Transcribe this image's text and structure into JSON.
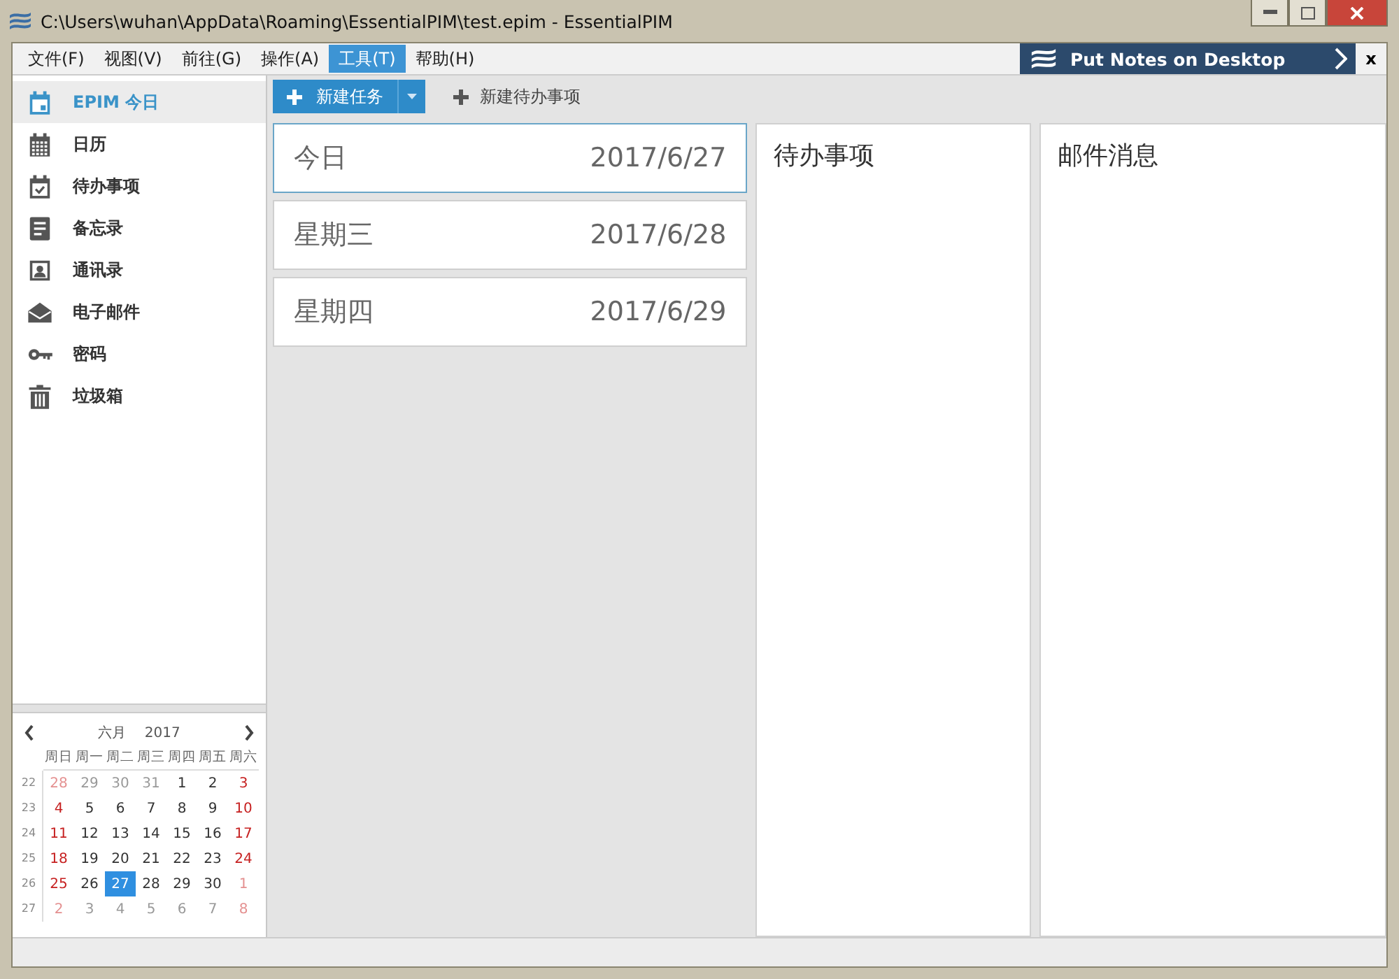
{
  "window": {
    "title": "C:\\Users\\wuhan\\AppData\\Roaming\\EssentialPIM\\test.epim - EssentialPIM"
  },
  "menu": [
    {
      "label": "文件(F)",
      "selected": false
    },
    {
      "label": "视图(V)",
      "selected": false
    },
    {
      "label": "前往(G)",
      "selected": false
    },
    {
      "label": "操作(A)",
      "selected": false
    },
    {
      "label": "工具(T)",
      "selected": true
    },
    {
      "label": "帮助(H)",
      "selected": false
    }
  ],
  "banner": {
    "text": "Put Notes on Desktop",
    "close": "x"
  },
  "sidebar": {
    "items": [
      {
        "label": "EPIM 今日",
        "kind": "today",
        "selected": true
      },
      {
        "label": "日历",
        "kind": "calendar",
        "selected": false
      },
      {
        "label": "待办事项",
        "kind": "todo",
        "selected": false
      },
      {
        "label": "备忘录",
        "kind": "note",
        "selected": false
      },
      {
        "label": "通讯录",
        "kind": "contact",
        "selected": false
      },
      {
        "label": "电子邮件",
        "kind": "mail",
        "selected": false
      },
      {
        "label": "密码",
        "kind": "key",
        "selected": false
      },
      {
        "label": "垃圾箱",
        "kind": "trash",
        "selected": false
      }
    ]
  },
  "mini_calendar": {
    "month": "六月",
    "year": "2017",
    "weekdays": [
      "周日",
      "周一",
      "周二",
      "周三",
      "周四",
      "周五",
      "周六"
    ],
    "weeks": [
      {
        "week": "22",
        "days": [
          {
            "d": "28",
            "other": true,
            "weekend": true,
            "selected": false
          },
          {
            "d": "29",
            "other": true,
            "weekend": false,
            "selected": false
          },
          {
            "d": "30",
            "other": true,
            "weekend": false,
            "selected": false
          },
          {
            "d": "31",
            "other": true,
            "weekend": false,
            "selected": false
          },
          {
            "d": "1",
            "other": false,
            "weekend": false,
            "selected": false
          },
          {
            "d": "2",
            "other": false,
            "weekend": false,
            "selected": false
          },
          {
            "d": "3",
            "other": false,
            "weekend": true,
            "selected": false
          }
        ]
      },
      {
        "week": "23",
        "days": [
          {
            "d": "4",
            "other": false,
            "weekend": true,
            "selected": false
          },
          {
            "d": "5",
            "other": false,
            "weekend": false,
            "selected": false
          },
          {
            "d": "6",
            "other": false,
            "weekend": false,
            "selected": false
          },
          {
            "d": "7",
            "other": false,
            "weekend": false,
            "selected": false
          },
          {
            "d": "8",
            "other": false,
            "weekend": false,
            "selected": false
          },
          {
            "d": "9",
            "other": false,
            "weekend": false,
            "selected": false
          },
          {
            "d": "10",
            "other": false,
            "weekend": true,
            "selected": false
          }
        ]
      },
      {
        "week": "24",
        "days": [
          {
            "d": "11",
            "other": false,
            "weekend": true,
            "selected": false
          },
          {
            "d": "12",
            "other": false,
            "weekend": false,
            "selected": false
          },
          {
            "d": "13",
            "other": false,
            "weekend": false,
            "selected": false
          },
          {
            "d": "14",
            "other": false,
            "weekend": false,
            "selected": false
          },
          {
            "d": "15",
            "other": false,
            "weekend": false,
            "selected": false
          },
          {
            "d": "16",
            "other": false,
            "weekend": false,
            "selected": false
          },
          {
            "d": "17",
            "other": false,
            "weekend": true,
            "selected": false
          }
        ]
      },
      {
        "week": "25",
        "days": [
          {
            "d": "18",
            "other": false,
            "weekend": true,
            "selected": false
          },
          {
            "d": "19",
            "other": false,
            "weekend": false,
            "selected": false
          },
          {
            "d": "20",
            "other": false,
            "weekend": false,
            "selected": false
          },
          {
            "d": "21",
            "other": false,
            "weekend": false,
            "selected": false
          },
          {
            "d": "22",
            "other": false,
            "weekend": false,
            "selected": false
          },
          {
            "d": "23",
            "other": false,
            "weekend": false,
            "selected": false
          },
          {
            "d": "24",
            "other": false,
            "weekend": true,
            "selected": false
          }
        ]
      },
      {
        "week": "26",
        "days": [
          {
            "d": "25",
            "other": false,
            "weekend": true,
            "selected": false
          },
          {
            "d": "26",
            "other": false,
            "weekend": false,
            "selected": false
          },
          {
            "d": "27",
            "other": false,
            "weekend": false,
            "selected": true
          },
          {
            "d": "28",
            "other": false,
            "weekend": false,
            "selected": false
          },
          {
            "d": "29",
            "other": false,
            "weekend": false,
            "selected": false
          },
          {
            "d": "30",
            "other": false,
            "weekend": false,
            "selected": false
          },
          {
            "d": "1",
            "other": true,
            "weekend": true,
            "selected": false
          }
        ]
      },
      {
        "week": "27",
        "days": [
          {
            "d": "2",
            "other": true,
            "weekend": true,
            "selected": false
          },
          {
            "d": "3",
            "other": true,
            "weekend": false,
            "selected": false
          },
          {
            "d": "4",
            "other": true,
            "weekend": false,
            "selected": false
          },
          {
            "d": "5",
            "other": true,
            "weekend": false,
            "selected": false
          },
          {
            "d": "6",
            "other": true,
            "weekend": false,
            "selected": false
          },
          {
            "d": "7",
            "other": true,
            "weekend": false,
            "selected": false
          },
          {
            "d": "8",
            "other": true,
            "weekend": true,
            "selected": false
          }
        ]
      }
    ]
  },
  "toolbar": {
    "new_task": "新建任务",
    "new_todo": "新建待办事项"
  },
  "days": [
    {
      "name": "今日",
      "date": "2017/6/27",
      "selected": true
    },
    {
      "name": "星期三",
      "date": "2017/6/28",
      "selected": false
    },
    {
      "name": "星期四",
      "date": "2017/6/29",
      "selected": false
    }
  ],
  "panels": [
    {
      "title": "待办事项"
    },
    {
      "title": "邮件消息"
    }
  ]
}
